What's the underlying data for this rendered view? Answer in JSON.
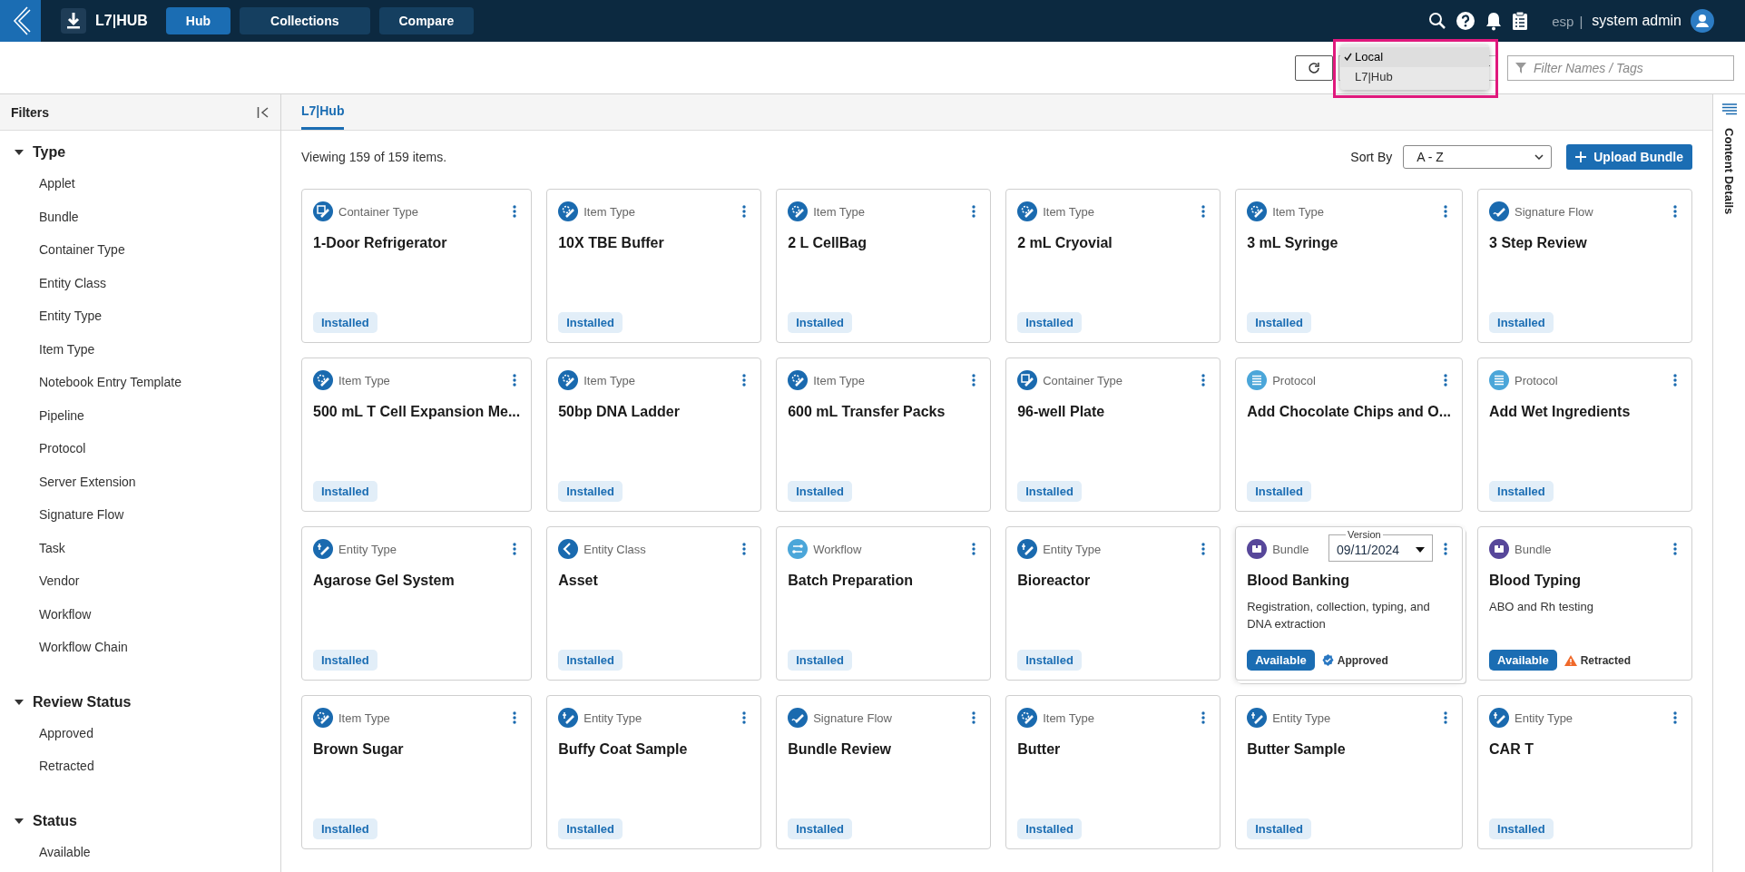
{
  "topbar": {
    "app_name": "L7|HUB",
    "tabs": [
      {
        "label": "Hub",
        "selected": true
      },
      {
        "label": "Collections",
        "selected": false
      },
      {
        "label": "Compare",
        "selected": false
      }
    ],
    "tenant": "esp",
    "separator": "|",
    "user": "system admin"
  },
  "toolbar": {
    "source_menu": {
      "options": [
        {
          "label": "Local",
          "selected": true
        },
        {
          "label": "L7|Hub",
          "selected": false
        }
      ],
      "highlighted": true
    },
    "filter": {
      "placeholder": "Filter Names / Tags"
    }
  },
  "filters": {
    "title": "Filters",
    "groups": [
      {
        "label": "Type",
        "expanded": true,
        "items": [
          "Applet",
          "Bundle",
          "Container Type",
          "Entity Class",
          "Entity Type",
          "Item Type",
          "Notebook Entry Template",
          "Pipeline",
          "Protocol",
          "Server Extension",
          "Signature Flow",
          "Task",
          "Vendor",
          "Workflow",
          "Workflow Chain"
        ]
      },
      {
        "label": "Review Status",
        "expanded": true,
        "items": [
          "Approved",
          "Retracted"
        ]
      },
      {
        "label": "Status",
        "expanded": true,
        "items": [
          "Available"
        ]
      }
    ]
  },
  "content": {
    "tabs": [
      {
        "label": "L7|Hub",
        "selected": true
      }
    ],
    "count": "Viewing 159 of 159 items.",
    "sort": {
      "label": "Sort By",
      "value": "A - Z"
    },
    "upload": "Upload Bundle",
    "side_panel": "Content Details",
    "cards": [
      {
        "type": "Container Type",
        "kind": "container",
        "title": "1-Door Refrigerator",
        "status": {
          "label": "Installed",
          "kind": "installed"
        }
      },
      {
        "type": "Item Type",
        "kind": "item",
        "title": "10X TBE Buffer",
        "status": {
          "label": "Installed",
          "kind": "installed"
        }
      },
      {
        "type": "Item Type",
        "kind": "item",
        "title": "2 L CellBag",
        "status": {
          "label": "Installed",
          "kind": "installed"
        }
      },
      {
        "type": "Item Type",
        "kind": "item",
        "title": "2 mL Cryovial",
        "status": {
          "label": "Installed",
          "kind": "installed"
        }
      },
      {
        "type": "Item Type",
        "kind": "item",
        "title": "3 mL Syringe",
        "status": {
          "label": "Installed",
          "kind": "installed"
        }
      },
      {
        "type": "Signature Flow",
        "kind": "signature",
        "title": "3 Step Review",
        "status": {
          "label": "Installed",
          "kind": "installed"
        }
      },
      {
        "type": "Item Type",
        "kind": "item",
        "title": "500 mL T Cell Expansion Me...",
        "status": {
          "label": "Installed",
          "kind": "installed"
        }
      },
      {
        "type": "Item Type",
        "kind": "item",
        "title": "50bp DNA Ladder",
        "status": {
          "label": "Installed",
          "kind": "installed"
        }
      },
      {
        "type": "Item Type",
        "kind": "item",
        "title": "600 mL Transfer Packs",
        "status": {
          "label": "Installed",
          "kind": "installed"
        }
      },
      {
        "type": "Container Type",
        "kind": "container",
        "title": "96-well Plate",
        "status": {
          "label": "Installed",
          "kind": "installed"
        }
      },
      {
        "type": "Protocol",
        "kind": "protocol",
        "title": "Add Chocolate Chips and O...",
        "status": {
          "label": "Installed",
          "kind": "installed"
        }
      },
      {
        "type": "Protocol",
        "kind": "protocol",
        "title": "Add Wet Ingredients",
        "status": {
          "label": "Installed",
          "kind": "installed"
        }
      },
      {
        "type": "Entity Type",
        "kind": "entity",
        "title": "Agarose Gel System",
        "status": {
          "label": "Installed",
          "kind": "installed"
        }
      },
      {
        "type": "Entity Class",
        "kind": "class",
        "title": "Asset",
        "status": {
          "label": "Installed",
          "kind": "installed"
        }
      },
      {
        "type": "Workflow",
        "kind": "workflow",
        "title": "Batch Preparation",
        "status": {
          "label": "Installed",
          "kind": "installed"
        }
      },
      {
        "type": "Entity Type",
        "kind": "entity",
        "title": "Bioreactor",
        "status": {
          "label": "Installed",
          "kind": "installed"
        }
      },
      {
        "type": "Bundle",
        "kind": "bundle",
        "title": "Blood Banking",
        "raised": true,
        "version": {
          "label": "Version",
          "value": "09/11/2024"
        },
        "description": "Registration, collection, typing, and DNA extraction",
        "status": {
          "label": "Available",
          "kind": "available"
        },
        "review": {
          "label": "Approved",
          "kind": "approved"
        }
      },
      {
        "type": "Bundle",
        "kind": "bundle",
        "title": "Blood Typing",
        "description": "ABO and Rh testing",
        "status": {
          "label": "Available",
          "kind": "available"
        },
        "review": {
          "label": "Retracted",
          "kind": "retracted"
        }
      },
      {
        "type": "Item Type",
        "kind": "item",
        "title": "Brown Sugar",
        "status": {
          "label": "Installed",
          "kind": "installed"
        }
      },
      {
        "type": "Entity Type",
        "kind": "entity",
        "title": "Buffy Coat Sample",
        "status": {
          "label": "Installed",
          "kind": "installed"
        }
      },
      {
        "type": "Signature Flow",
        "kind": "signature",
        "title": "Bundle Review",
        "status": {
          "label": "Installed",
          "kind": "installed"
        }
      },
      {
        "type": "Item Type",
        "kind": "item",
        "title": "Butter",
        "status": {
          "label": "Installed",
          "kind": "installed"
        }
      },
      {
        "type": "Entity Type",
        "kind": "entity",
        "title": "Butter Sample",
        "status": {
          "label": "Installed",
          "kind": "installed"
        }
      },
      {
        "type": "Entity Type",
        "kind": "entity",
        "title": "CAR T",
        "status": {
          "label": "Installed",
          "kind": "installed"
        }
      }
    ]
  }
}
